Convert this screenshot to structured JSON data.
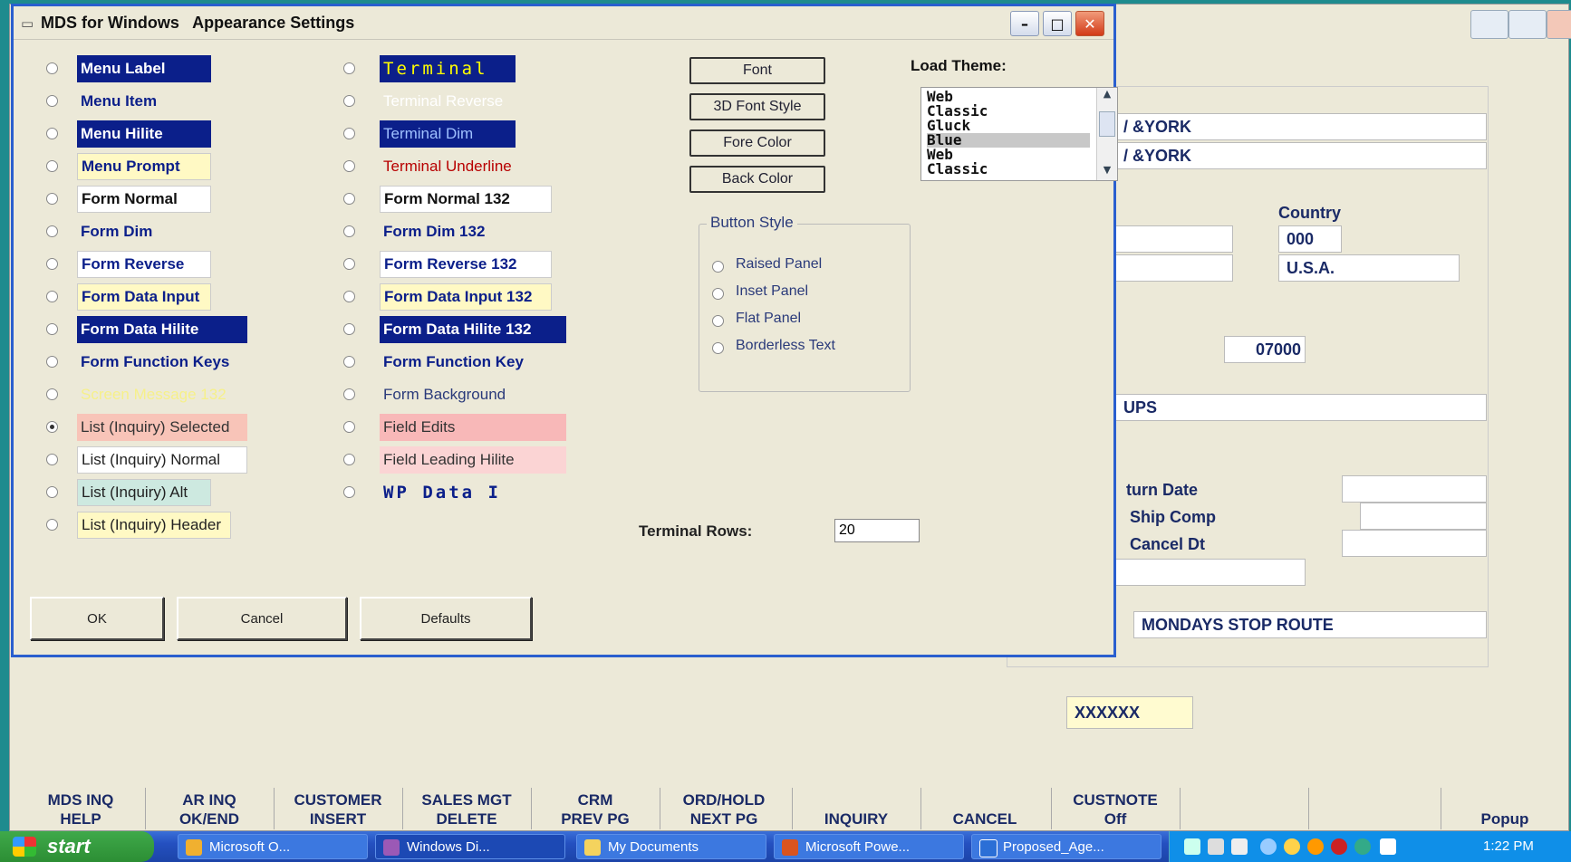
{
  "background_window": {
    "fields": [
      "/ &YORK",
      "/ &YORK",
      "000",
      "U.S.A.",
      "07000",
      "UPS",
      "MONDAYS STOP ROUTE",
      "XXXXXX"
    ],
    "labels": [
      "Country",
      "turn Date",
      "Ship Comp",
      "Cancel Dt"
    ]
  },
  "fkeys": {
    "top": [
      "MDS INQ",
      "AR INQ",
      "CUSTOMER",
      "SALES MGT",
      "CRM",
      "ORD/HOLD",
      "",
      "",
      "CUSTNOTE"
    ],
    "bottom": [
      "HELP",
      "OK/END",
      "INSERT",
      "DELETE",
      "PREV PG",
      "NEXT PG",
      "INQUIRY",
      "CANCEL",
      "Off"
    ],
    "popup": "Popup"
  },
  "dialog": {
    "title": "MDS for Windows   Appearance Settings",
    "left_items": [
      {
        "label": "Menu Label",
        "fg": "#ffffff",
        "bg": "#0b1f8a",
        "bold": true
      },
      {
        "label": "Menu Item",
        "fg": "#0b1f8a",
        "bg": "#ece9d8",
        "bold": true
      },
      {
        "label": "Menu Hilite",
        "fg": "#ffffff",
        "bg": "#0b1f8a",
        "bold": true
      },
      {
        "label": "Menu Prompt",
        "fg": "#0b1f8a",
        "bg": "#fff9c4",
        "bold": true
      },
      {
        "label": "Form Normal",
        "fg": "#111111",
        "bg": "#ffffff",
        "bold": true
      },
      {
        "label": "Form Dim",
        "fg": "#0b1f8a",
        "bg": "#ece9d8",
        "bold": true
      },
      {
        "label": "Form Reverse",
        "fg": "#0b1f8a",
        "bg": "#ffffff",
        "bold": true
      },
      {
        "label": "Form Data Input",
        "fg": "#0b1f8a",
        "bg": "#fff9c4",
        "bold": true
      },
      {
        "label": "Form Data Hilite",
        "fg": "#ffffff",
        "bg": "#0b1f8a",
        "bold": true
      },
      {
        "label": "Form Function Keys",
        "fg": "#0b1f8a",
        "bg": "#ece9d8",
        "bold": true
      },
      {
        "label": "Screen Message 132",
        "fg": "#f6f08a",
        "bg": "#ece9d8",
        "bold": false
      },
      {
        "label": "List (Inquiry) Selected",
        "fg": "#333333",
        "bg": "#f8c4b8",
        "bold": false
      },
      {
        "label": "List (Inquiry) Normal",
        "fg": "#222222",
        "bg": "#ffffff",
        "bold": false
      },
      {
        "label": "List (Inquiry) Alt",
        "fg": "#222222",
        "bg": "#cde9e0",
        "bold": false
      },
      {
        "label": "List (Inquiry) Header",
        "fg": "#222222",
        "bg": "#fff9c4",
        "bold": false
      }
    ],
    "selected_index": 11,
    "right_items": [
      {
        "label": "Terminal",
        "fg": "#ffff00",
        "bg": "#0b1f8a",
        "bold": false,
        "mono": true
      },
      {
        "label": "Terminal Reverse",
        "fg": "#ffffff",
        "bg": "#ece9d8",
        "bold": false
      },
      {
        "label": "Terminal Dim",
        "fg": "#9fc0ff",
        "bg": "#0b1f8a",
        "bold": false
      },
      {
        "label": "Terminal Underline",
        "fg": "#b80000",
        "bg": "#ece9d8",
        "bold": false
      },
      {
        "label": "Form Normal 132",
        "fg": "#111111",
        "bg": "#ffffff",
        "bold": true
      },
      {
        "label": "Form Dim 132",
        "fg": "#0b1f8a",
        "bg": "#ece9d8",
        "bold": true
      },
      {
        "label": "Form Reverse 132",
        "fg": "#0b1f8a",
        "bg": "#ffffff",
        "bold": true
      },
      {
        "label": "Form Data Input 132",
        "fg": "#0b1f8a",
        "bg": "#fff9c4",
        "bold": true
      },
      {
        "label": "Form Data Hilite 132",
        "fg": "#ffffff",
        "bg": "#0b1f8a",
        "bold": true
      },
      {
        "label": "Form Function Key",
        "fg": "#0b1f8a",
        "bg": "#ece9d8",
        "bold": true
      },
      {
        "label": "Form Background",
        "fg": "#2a3a7a",
        "bg": "#ece9d8",
        "bold": false
      },
      {
        "label": "Field Edits",
        "fg": "#333333",
        "bg": "#f8b8b8",
        "bold": false
      },
      {
        "label": "Field Leading Hilite",
        "fg": "#333333",
        "bg": "#fbd4d4",
        "bold": false
      },
      {
        "label": "WP Data I",
        "fg": "#0b1f8a",
        "bg": "#ece9d8",
        "bold": true,
        "mono": true
      }
    ],
    "font_buttons": [
      "Font",
      "3D Font Style",
      "Fore Color",
      "Back Color"
    ],
    "button_style": {
      "label": "Button Style",
      "options": [
        "Raised Panel",
        "Inset Panel",
        "Flat Panel",
        "Borderless Text"
      ]
    },
    "load_theme": {
      "label": "Load Theme:",
      "options": [
        "Web",
        "Classic",
        "Gluck",
        "Blue",
        "Web",
        "Classic"
      ],
      "selected_index": 3
    },
    "terminal_rows": {
      "label": "Terminal Rows:",
      "value": "20"
    },
    "buttons": [
      "OK",
      "Cancel",
      "Defaults"
    ]
  },
  "taskbar": {
    "start": "start",
    "items": [
      "Microsoft O...",
      "Windows Di...",
      "My Documents",
      "Microsoft Powe...",
      "Proposed_Age..."
    ],
    "active_index": 1,
    "clock": "1:22 PM"
  },
  "colors": {
    "desktop": "#1e8b8e",
    "dialog_border": "#2a5fcf",
    "navy": "#0b1f8a"
  }
}
